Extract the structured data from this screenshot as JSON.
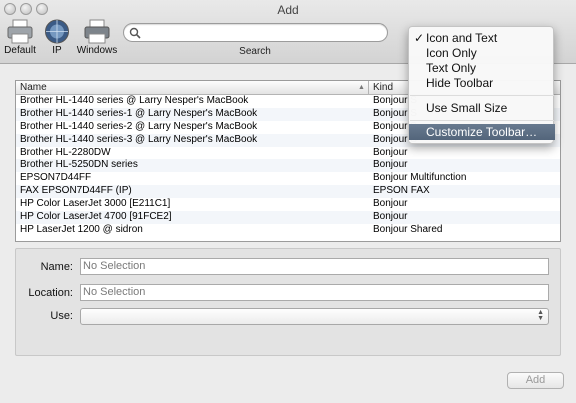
{
  "window": {
    "title": "Add"
  },
  "toolbar": {
    "items": [
      {
        "label": "Default"
      },
      {
        "label": "IP"
      },
      {
        "label": "Windows"
      }
    ],
    "search_label": "Search",
    "search_value": ""
  },
  "table": {
    "columns": {
      "name": "Name",
      "kind": "Kind"
    },
    "rows": [
      {
        "name": "Brother HL-1440 series @ Larry Nesper's MacBook",
        "kind": "Bonjour S"
      },
      {
        "name": "Brother HL-1440 series-1 @ Larry Nesper's MacBook",
        "kind": "Bonjour S"
      },
      {
        "name": "Brother HL-1440 series-2 @ Larry Nesper's MacBook",
        "kind": "Bonjour S"
      },
      {
        "name": "Brother HL-1440 series-3 @ Larry Nesper's MacBook",
        "kind": "Bonjour S"
      },
      {
        "name": "Brother HL-2280DW",
        "kind": "Bonjour"
      },
      {
        "name": "Brother HL-5250DN series",
        "kind": "Bonjour"
      },
      {
        "name": "EPSON7D44FF",
        "kind": "Bonjour Multifunction"
      },
      {
        "name": "FAX EPSON7D44FF (IP)",
        "kind": "EPSON FAX"
      },
      {
        "name": "HP Color LaserJet 3000 [E211C1]",
        "kind": "Bonjour"
      },
      {
        "name": "HP Color LaserJet 4700 [91FCE2]",
        "kind": "Bonjour"
      },
      {
        "name": "HP LaserJet 1200 @ sidron",
        "kind": "Bonjour Shared"
      }
    ]
  },
  "details": {
    "name_label": "Name:",
    "name_placeholder": "No Selection",
    "location_label": "Location:",
    "location_placeholder": "No Selection",
    "use_label": "Use:",
    "use_value": ""
  },
  "add_button": "Add",
  "context_menu": {
    "items": [
      {
        "label": "Icon and Text",
        "checked": true
      },
      {
        "label": "Icon Only"
      },
      {
        "label": "Text Only"
      },
      {
        "label": "Hide Toolbar"
      },
      {
        "label": "Use Small Size"
      },
      {
        "label": "Customize Toolbar…",
        "highlighted": true
      }
    ]
  },
  "colors": {
    "menu_highlight": "#5a6c82",
    "row_stripe": "#f3f6fa"
  }
}
